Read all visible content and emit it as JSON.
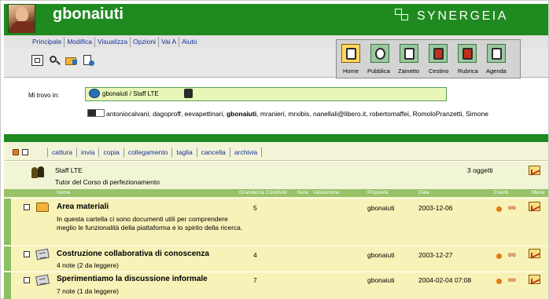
{
  "header": {
    "username": "gbonaiuti",
    "brand": "SYNERGEIA"
  },
  "menu": [
    "Principale",
    "Modifica",
    "Visualizza",
    "Opzioni",
    "Vai A",
    "Aiuto"
  ],
  "toolbar_small": [
    "home-small-icon",
    "search-icon",
    "folder-go-icon",
    "document-add-icon"
  ],
  "toolbar_big": [
    {
      "label": "Home",
      "icon": "home-icon"
    },
    {
      "label": "Pubblica",
      "icon": "publish-icon"
    },
    {
      "label": "Zainetto",
      "icon": "backpack-icon"
    },
    {
      "label": "Cestino",
      "icon": "trash-icon"
    },
    {
      "label": "Rubrica",
      "icon": "address-book-icon"
    },
    {
      "label": "Agenda",
      "icon": "calendar-icon"
    }
  ],
  "location": {
    "label": "Mi trovo in:",
    "path": "gbonaiuti / Staff LTE",
    "members_before": "antoniocalvani, dagoproff, eevapettinari, ",
    "members_bold": "gbonaiuti",
    "members_after": ", mranieri, mrxibis, nanellali@libero.it, robertomaffei, RomoloPranzetti, Simone"
  },
  "actions": [
    "cattura",
    "invia",
    "copia",
    "collegamento",
    "taglia",
    "cancella",
    "archivia"
  ],
  "folder": {
    "title": "Staff LTE",
    "subtitle": "Tutor del Corso di perfezionamento",
    "count": "3 oggetti"
  },
  "columns": [
    "Nome",
    "Grandezza",
    "Condividi",
    "Nota",
    "Valutazione",
    "Proprietà",
    "Data",
    "Eventi",
    "Menu"
  ],
  "items": [
    {
      "title": "Area materiali",
      "description": "In questa cartella ci sono documenti utili per comprendere meglio le funzionalità della piattaforma e lo spirito della ricerca.",
      "size": "5",
      "owner": "gbonaiuti",
      "date": "2003-12-06",
      "icon": "folder-icon"
    },
    {
      "title": "Costruzione collaborativa di conoscenza",
      "description": "4 note (2 da leggere)",
      "size": "4",
      "owner": "gbonaiuti",
      "date": "2003-12-27",
      "icon": "discussion-icon"
    },
    {
      "title": "Sperimentiamo la discussione informale",
      "description": "7 note (1 da leggere)",
      "size": "7",
      "owner": "gbonaiuti",
      "date": "2004-02-04 07:08",
      "icon": "discussion-icon"
    }
  ],
  "colors": {
    "accent": "#1f8a1f",
    "panel": "#f7f2b8",
    "column_header": "#98c26a"
  }
}
